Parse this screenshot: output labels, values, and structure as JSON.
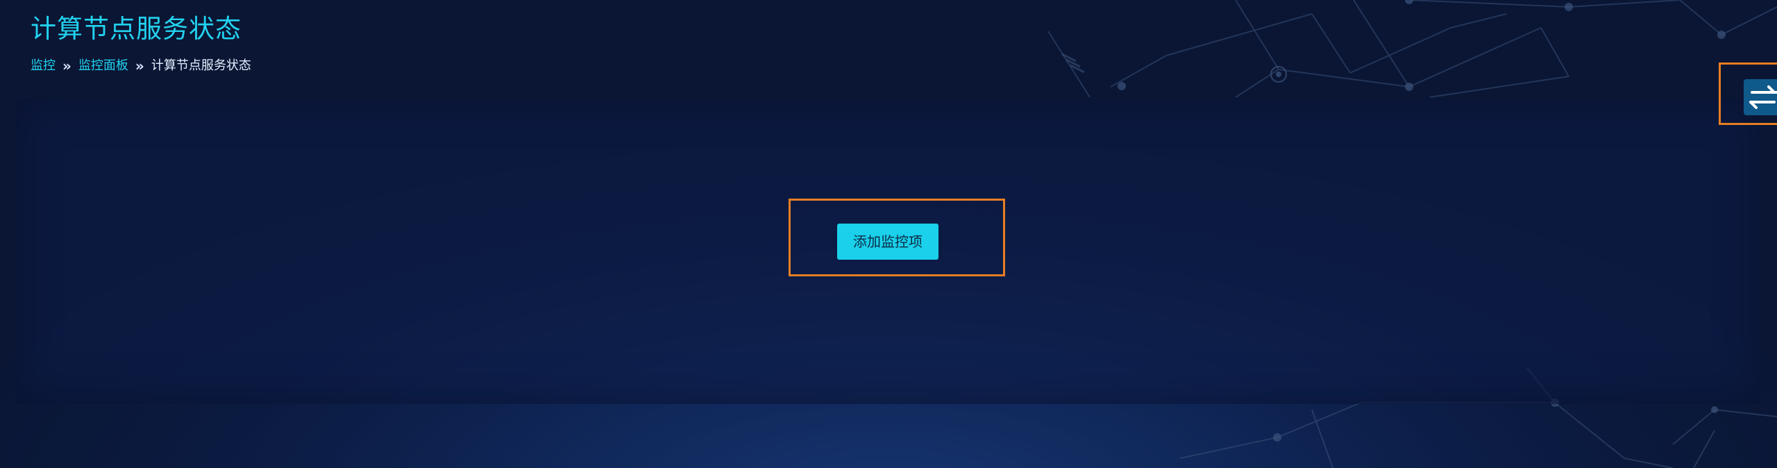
{
  "page": {
    "title": "计算节点服务状态"
  },
  "breadcrumb": {
    "items": [
      {
        "label": "监控",
        "link": true
      },
      {
        "label": "监控面板",
        "link": true
      },
      {
        "label": "计算节点服务状态",
        "link": false
      }
    ],
    "separator": "»"
  },
  "main": {
    "add_button_label": "添加监控项"
  },
  "side": {
    "switch_icon": "swap-arrows-icon"
  },
  "colors": {
    "accent": "#22d3f0",
    "button": "#1ad0ea",
    "highlight": "#e67e22",
    "background": "#0b1a40"
  }
}
